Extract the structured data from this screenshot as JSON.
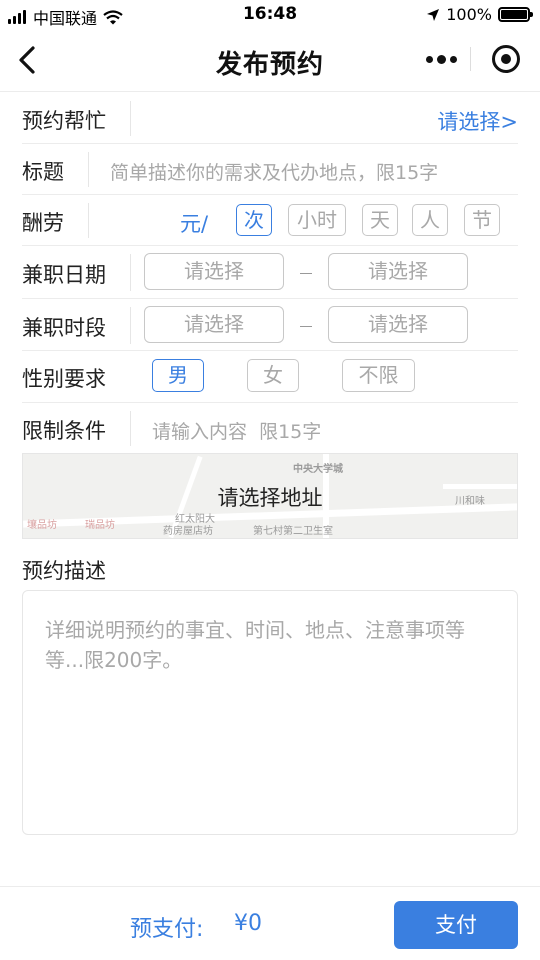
{
  "status_bar": {
    "carrier": "中国联通",
    "time": "16:48",
    "battery": "100%",
    "battery_level": 1.0
  },
  "nav": {
    "title": "发布预约",
    "icons": [
      "chevron-left-icon",
      "more-dots-icon",
      "close-target-icon"
    ]
  },
  "form": {
    "help": {
      "label": "预约帮忙",
      "value": "请选择>"
    },
    "title_field": {
      "label": "标题",
      "placeholder": "简单描述你的需求及代办地点，限15字"
    },
    "reward": {
      "label": "酬劳",
      "prefix": "元/",
      "units": [
        "次",
        "小时",
        "天",
        "人",
        "节"
      ],
      "selected": "次"
    },
    "date": {
      "label": "兼职日期",
      "start": "请选择",
      "end": "请选择"
    },
    "time_slot": {
      "label": "兼职时段",
      "start": "请选择",
      "end": "请选择"
    },
    "gender": {
      "label": "性别要求",
      "options": [
        "男",
        "女",
        "不限"
      ],
      "selected": "男"
    },
    "limit": {
      "label": "限制条件",
      "placeholder": "请输入内容  限15字"
    }
  },
  "map": {
    "cta": "请选择地址",
    "labels": [
      "中央大学城",
      "川和味",
      "红太阳大",
      "药房屋店坊",
      "第七村第二卫生室",
      "壤品坊",
      "瑞品坊"
    ]
  },
  "description": {
    "title": "预约描述",
    "placeholder": "详细说明预约的事宜、时间、地点、注意事项等等...限200字。"
  },
  "footer": {
    "prepay_label": "预支付:",
    "prepay_amount": "¥0",
    "pay_button": "支付"
  },
  "colors": {
    "accent": "#3a7fe0",
    "placeholder": "#a8a8a8",
    "border": "#c8c8c8"
  }
}
